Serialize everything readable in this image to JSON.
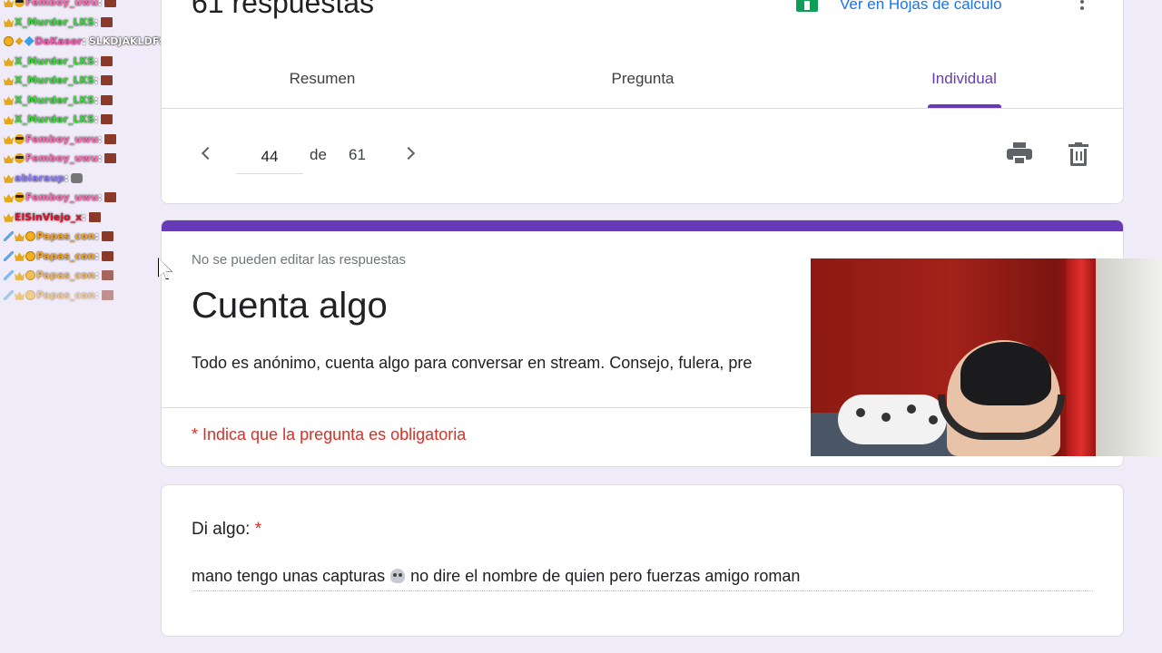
{
  "chat": [
    {
      "badges": [
        "crown",
        "sunglasses"
      ],
      "user": "Femboy_uwu",
      "user_color": "#ff69b4",
      "text": "",
      "emote": "brick",
      "fade": ""
    },
    {
      "badges": [
        "crown"
      ],
      "user": "X_Murder_LKS",
      "user_color": "#3cd63c",
      "text": "",
      "emote": "brick",
      "fade": ""
    },
    {
      "badges": [
        "coin",
        "gem",
        "cube"
      ],
      "user": "DaKasor",
      "user_color": "#ff4fb0",
      "text": "SLKDJAKLDFSAJDFKSADF",
      "emote": "",
      "fade": ""
    },
    {
      "badges": [
        "crown"
      ],
      "user": "X_Murder_LKS",
      "user_color": "#3cd63c",
      "text": "",
      "emote": "brick",
      "fade": ""
    },
    {
      "badges": [
        "crown"
      ],
      "user": "X_Murder_LKS",
      "user_color": "#3cd63c",
      "text": "",
      "emote": "brick",
      "fade": ""
    },
    {
      "badges": [
        "crown"
      ],
      "user": "X_Murder_LKS",
      "user_color": "#3cd63c",
      "text": "",
      "emote": "brick",
      "fade": ""
    },
    {
      "badges": [
        "crown"
      ],
      "user": "X_Murder_LKS",
      "user_color": "#3cd63c",
      "text": "",
      "emote": "brick",
      "fade": ""
    },
    {
      "badges": [
        "crown",
        "sunglasses"
      ],
      "user": "Femboy_uwu",
      "user_color": "#ff69b4",
      "text": "",
      "emote": "brick",
      "fade": ""
    },
    {
      "badges": [
        "crown",
        "sunglasses"
      ],
      "user": "Femboy_uwu",
      "user_color": "#ff69b4",
      "text": "",
      "emote": "brick",
      "fade": ""
    },
    {
      "badges": [
        "crown"
      ],
      "user": "abiaraup",
      "user_color": "#8a7bff",
      "text": "",
      "emote": "cat",
      "fade": ""
    },
    {
      "badges": [
        "crown",
        "sunglasses"
      ],
      "user": "Femboy_uwu",
      "user_color": "#ff69b4",
      "text": "",
      "emote": "brick",
      "fade": ""
    },
    {
      "badges": [
        "crown"
      ],
      "user": "ElSinViejo_x",
      "user_color": "#e0102a",
      "text": "",
      "emote": "brick",
      "fade": ""
    },
    {
      "badges": [
        "sword",
        "crown",
        "coin"
      ],
      "user": "Papas_con",
      "user_color": "#f2a32a",
      "text": "",
      "emote": "brick",
      "fade": ""
    },
    {
      "badges": [
        "sword",
        "crown",
        "coin"
      ],
      "user": "Papas_con",
      "user_color": "#f2a32a",
      "text": "",
      "emote": "brick",
      "fade": ""
    },
    {
      "badges": [
        "sword",
        "crown",
        "coin"
      ],
      "user": "Papas_con",
      "user_color": "#f2a32a",
      "text": "",
      "emote": "brick",
      "fade": "faded"
    },
    {
      "badges": [
        "sword",
        "crown",
        "coin"
      ],
      "user": "Papas_con",
      "user_color": "#f2a32a",
      "text": "",
      "emote": "brick",
      "fade": "faded2"
    }
  ],
  "summary": {
    "response_count": "61 respuestas",
    "sheets_link": "Ver en Hojas de cálculo",
    "tabs": {
      "resumen": "Resumen",
      "pregunta": "Pregunta",
      "individual": "Individual"
    },
    "pager": {
      "current": "44",
      "de": "de",
      "total": "61"
    }
  },
  "form": {
    "no_edit": "No se pueden editar las respuestas",
    "title": "Cuenta algo",
    "description": "Todo es anónimo, cuenta algo para conversar en stream. Consejo, fulera, pre",
    "required_note": "* Indica que la pregunta es obligatoria"
  },
  "question": {
    "label": "Di algo:",
    "star": "*",
    "answer_part1": "mano tengo unas capturas",
    "answer_part2": "no dire el nombre de quien pero fuerzas amigo roman"
  },
  "colors": {
    "accent": "#673ab7",
    "required": "#d93025",
    "link": "#1a73e8",
    "background": "#f0ebf8"
  }
}
